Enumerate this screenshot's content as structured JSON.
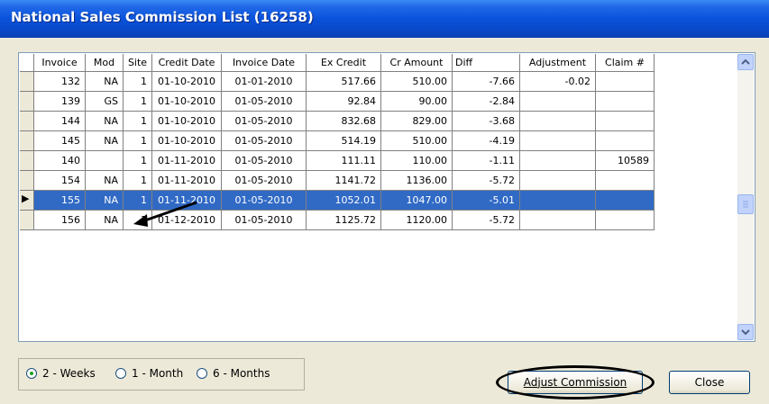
{
  "window": {
    "title": "National Sales Commission List (16258)"
  },
  "grid": {
    "columns": [
      "Invoice",
      "Mod",
      "Site",
      "Credit Date",
      "Invoice Date",
      "Ex Credit",
      "Cr Amount",
      "Diff",
      "Adjustment",
      "Claim #"
    ],
    "rows": [
      [
        "132",
        "NA",
        "1",
        "01-10-2010",
        "01-01-2010",
        "517.66",
        "510.00",
        "-7.66",
        "-0.02",
        ""
      ],
      [
        "139",
        "GS",
        "1",
        "01-10-2010",
        "01-05-2010",
        "92.84",
        "90.00",
        "-2.84",
        "",
        ""
      ],
      [
        "144",
        "NA",
        "1",
        "01-10-2010",
        "01-05-2010",
        "832.68",
        "829.00",
        "-3.68",
        "",
        ""
      ],
      [
        "145",
        "NA",
        "1",
        "01-10-2010",
        "01-05-2010",
        "514.19",
        "510.00",
        "-4.19",
        "",
        ""
      ],
      [
        "140",
        "",
        "1",
        "01-11-2010",
        "01-05-2010",
        "111.11",
        "110.00",
        "-1.11",
        "",
        "10589"
      ],
      [
        "154",
        "NA",
        "1",
        "01-11-2010",
        "01-05-2010",
        "1141.72",
        "1136.00",
        "-5.72",
        "",
        ""
      ],
      [
        "155",
        "NA",
        "1",
        "01-11-2010",
        "01-05-2010",
        "1052.01",
        "1047.00",
        "-5.01",
        "",
        ""
      ],
      [
        "156",
        "NA",
        "1",
        "01-12-2010",
        "01-05-2010",
        "1125.72",
        "1120.00",
        "-5.72",
        "",
        ""
      ]
    ],
    "selected_row": 6,
    "current_row_indicator": "▶"
  },
  "period_options": [
    {
      "label": "2 - Weeks",
      "checked": true
    },
    {
      "label": "1 - Month",
      "checked": false
    },
    {
      "label": "6 - Months",
      "checked": false
    }
  ],
  "buttons": {
    "adjust": "Adjust Commission",
    "close": "Close"
  },
  "icons": {
    "scroll_up": "scroll-up-arrow-icon",
    "scroll_down": "scroll-down-arrow-icon",
    "annotation": "arrow-annotation-icon"
  },
  "colors": {
    "title_bar": "#0a52da",
    "selection": "#316ac5",
    "window_bg": "#ece9d8"
  }
}
